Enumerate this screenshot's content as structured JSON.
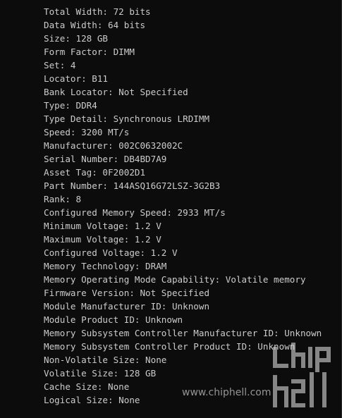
{
  "terminal": {
    "lines": [
      "Total Width: 72 bits",
      "Data Width: 64 bits",
      "Size: 128 GB",
      "Form Factor: DIMM",
      "Set: 4",
      "Locator: B11",
      "Bank Locator: Not Specified",
      "Type: DDR4",
      "Type Detail: Synchronous LRDIMM",
      "Speed: 3200 MT/s",
      "Manufacturer: 002C0632002C",
      "Serial Number: DB4BD7A9",
      "Asset Tag: 0F2002D1",
      "Part Number: 144ASQ16G72LSZ-3G2B3",
      "Rank: 8",
      "Configured Memory Speed: 2933 MT/s",
      "Minimum Voltage: 1.2 V",
      "Maximum Voltage: 1.2 V",
      "Configured Voltage: 1.2 V",
      "Memory Technology: DRAM",
      "Memory Operating Mode Capability: Volatile memory",
      "Firmware Version: Not Specified",
      "Module Manufacturer ID: Unknown",
      "Module Product ID: Unknown",
      "Memory Subsystem Controller Manufacturer ID: Unknown",
      "Memory Subsystem Controller Product ID: Unknown",
      "Non-Volatile Size: None",
      "Volatile Size: 128 GB",
      "Cache Size: None",
      "Logical Size: None"
    ]
  },
  "watermark": {
    "site": "www.chiphell.com",
    "logo_icon": "chiphell-logo-icon"
  },
  "colors": {
    "background": "#0c0c0c",
    "text": "#cccccc",
    "watermark": "#c8c8c8"
  }
}
